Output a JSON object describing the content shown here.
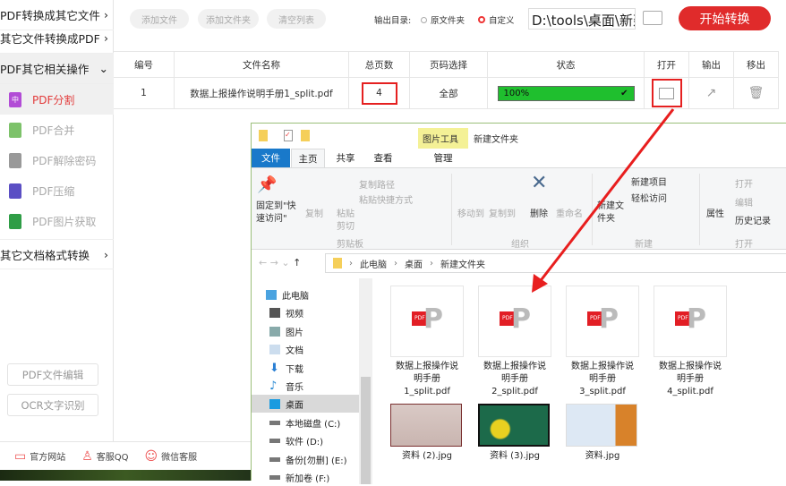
{
  "sidebar": {
    "groups": [
      "PDF转换成其它文件",
      "其它文件转换成PDF",
      "PDF其它相关操作",
      "其它文档格式转换"
    ],
    "items": [
      "PDF分割",
      "PDF合并",
      "PDF解除密码",
      "PDF压缩",
      "PDF图片获取"
    ],
    "buttons": [
      "PDF文件编辑",
      "OCR文字识别"
    ]
  },
  "toolbar": {
    "add_file": "添加文件",
    "add_folder": "添加文件夹",
    "clear_list": "清空列表",
    "output_dir_label": "输出目录:",
    "opt_original": "原文件夹",
    "opt_custom": "自定义",
    "path_value": "D:\\tools\\桌面\\新建",
    "start": "开始转换"
  },
  "table": {
    "headers": [
      "编号",
      "文件名称",
      "总页数",
      "页码选择",
      "状态",
      "打开",
      "输出",
      "移出"
    ],
    "row": {
      "index": "1",
      "name": "数据上报操作说明手册1_split.pdf",
      "pages": "4",
      "range": "全部",
      "status": "100%",
      "progress": 100
    }
  },
  "footer": {
    "site": "官方网站",
    "qq": "客服QQ",
    "wechat": "微信客服"
  },
  "explorer": {
    "title": "新建文件夹",
    "context_tab": "图片工具",
    "tabs": [
      "文件",
      "主页",
      "共享",
      "查看",
      "管理"
    ],
    "ribbon": {
      "pin": "固定到\"快速访问\"",
      "copy": "复制",
      "paste": "粘贴",
      "copy_path": "复制路径",
      "paste_shortcut": "粘贴快捷方式",
      "cut": "剪切",
      "move_to": "移动到",
      "copy_to": "复制到",
      "delete": "删除",
      "rename": "重命名",
      "new_folder": "新建文件夹",
      "new_item": "新建项目",
      "easy_access": "轻松访问",
      "properties": "属性",
      "open": "打开",
      "edit": "编辑",
      "history": "历史记录",
      "groups": [
        "剪贴板",
        "组织",
        "新建",
        "打开"
      ]
    },
    "breadcrumb": [
      "此电脑",
      "桌面",
      "新建文件夹"
    ],
    "nav": [
      "此电脑",
      "视频",
      "图片",
      "文档",
      "下载",
      "音乐",
      "桌面",
      "本地磁盘 (C:)",
      "软件 (D:)",
      "备份[勿删] (E:)",
      "新加卷 (F:)"
    ],
    "files": [
      {
        "line1": "数据上报操作说",
        "line2": "明手册",
        "line3": "1_split.pdf"
      },
      {
        "line1": "数据上报操作说",
        "line2": "明手册",
        "line3": "2_split.pdf"
      },
      {
        "line1": "数据上报操作说",
        "line2": "明手册",
        "line3": "3_split.pdf"
      },
      {
        "line1": "数据上报操作说",
        "line2": "明手册",
        "line3": "4_split.pdf"
      }
    ],
    "images": [
      "资料 (2).jpg",
      "资料 (3).jpg",
      "资料.jpg"
    ]
  },
  "colors": {
    "accent": "#e02b2b",
    "progress": "#1fbf2e",
    "explorer_file_tab": "#1979ca",
    "context_tab": "#f4f196"
  }
}
